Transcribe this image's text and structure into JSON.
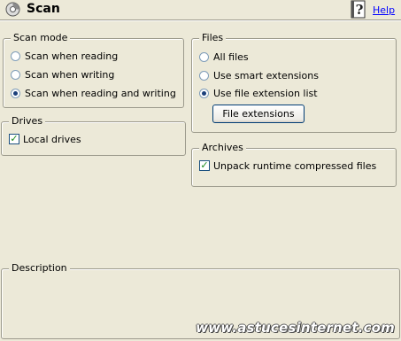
{
  "header": {
    "title": "Scan",
    "help": "Help",
    "icon": "scan-icon",
    "help_icon": "question-book-icon"
  },
  "scan_mode": {
    "legend": "Scan mode",
    "options": [
      "Scan when reading",
      "Scan when writing",
      "Scan when reading and writing"
    ],
    "selected": 2
  },
  "drives": {
    "legend": "Drives",
    "local_drives": "Local drives",
    "local_drives_checked": true
  },
  "files": {
    "legend": "Files",
    "options": [
      "All files",
      "Use smart extensions",
      "Use file extension list"
    ],
    "selected": 2,
    "button": "File extensions"
  },
  "archives": {
    "legend": "Archives",
    "unpack": "Unpack runtime compressed files",
    "unpack_checked": true
  },
  "description": {
    "legend": "Description"
  },
  "watermark": "www.astucesinternet.com"
}
